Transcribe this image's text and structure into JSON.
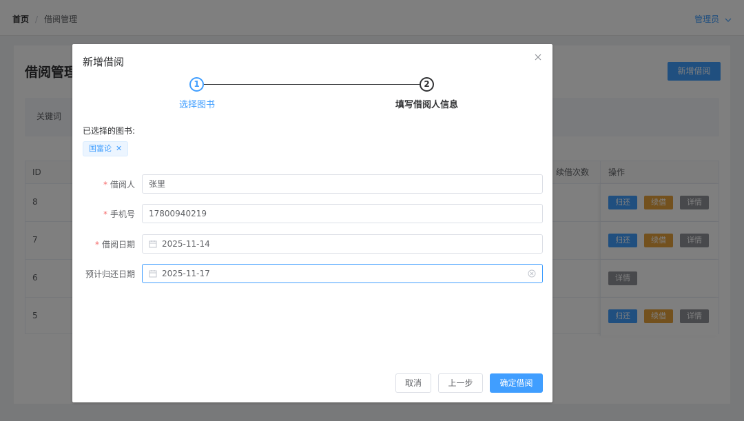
{
  "header": {
    "breadcrumb": [
      "首页",
      "借阅管理"
    ],
    "separator": "/",
    "user": "管理员"
  },
  "page": {
    "title": "借阅管理",
    "add_button": "新增借阅",
    "search_label": "关键词"
  },
  "table": {
    "columns": {
      "id": "ID",
      "renew_count": "续借次数",
      "actions": "操作"
    },
    "rows": [
      {
        "id": "8",
        "actions": [
          "归还",
          "续借",
          "详情"
        ]
      },
      {
        "id": "7",
        "actions": [
          "归还",
          "续借",
          "详情"
        ]
      },
      {
        "id": "6",
        "actions": [
          "详情"
        ]
      },
      {
        "id": "5",
        "actions": [
          "归还",
          "续借",
          "详情"
        ]
      }
    ]
  },
  "dialog": {
    "title": "新增借阅",
    "steps": [
      {
        "index": "1",
        "title": "选择图书",
        "state": "finished"
      },
      {
        "index": "2",
        "title": "填写借阅人信息",
        "state": "active"
      }
    ],
    "selected_books_label": "已选择的图书:",
    "selected_books": [
      "国富论"
    ],
    "form": {
      "borrower": {
        "label": "借阅人",
        "required": true,
        "value": "张里"
      },
      "phone": {
        "label": "手机号",
        "required": true,
        "value": "17800940219"
      },
      "borrow_date": {
        "label": "借阅日期",
        "required": true,
        "value": "2025-11-14"
      },
      "due_date": {
        "label": "预计归还日期",
        "required": false,
        "value": "2025-11-17"
      }
    },
    "buttons": {
      "cancel": "取消",
      "prev": "上一步",
      "confirm": "确定借阅"
    }
  },
  "colors": {
    "primary": "#409eff",
    "warning": "#e6a23c",
    "info": "#909399",
    "danger": "#f56c6c"
  }
}
